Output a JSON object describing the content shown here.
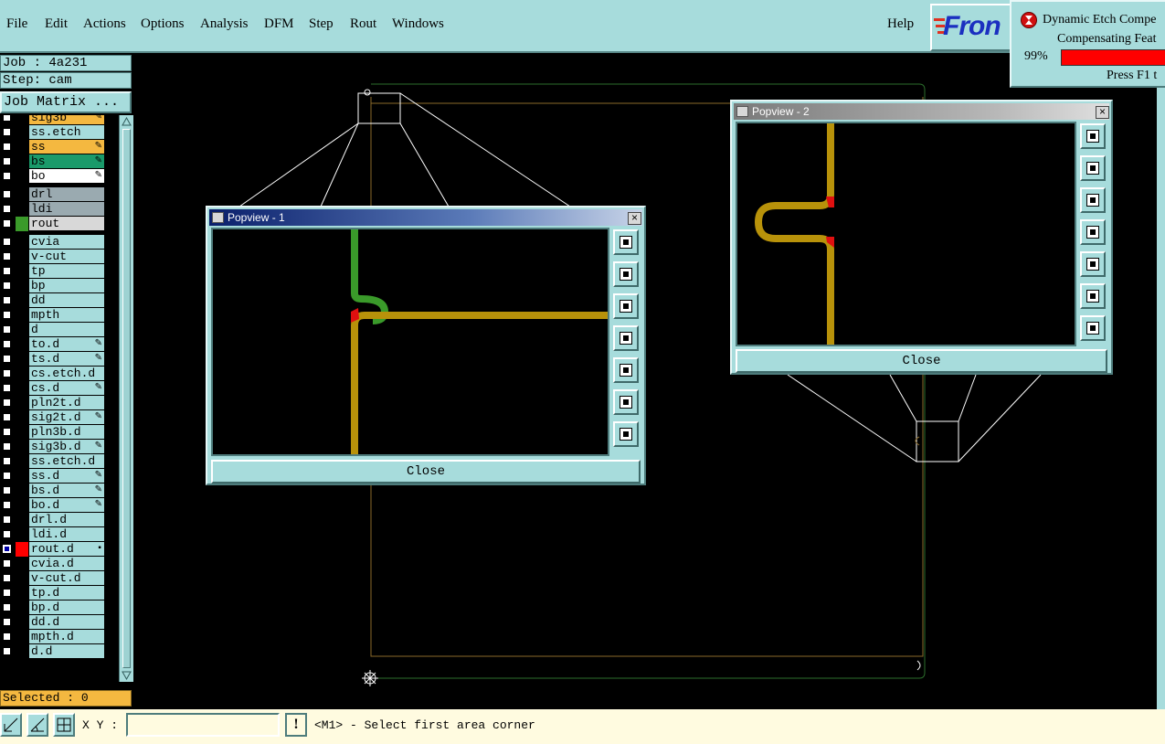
{
  "menu": {
    "file": "File",
    "edit": "Edit",
    "actions": "Actions",
    "options": "Options",
    "analysis": "Analysis",
    "dfm": "DFM",
    "step": "Step",
    "rout": "Rout",
    "windows": "Windows",
    "help": "Help"
  },
  "logo": {
    "text": "Fron"
  },
  "progress": {
    "title": "Dynamic Etch Compe",
    "subtitle": "Compensating Feat",
    "percent_label": "99%",
    "percent": 99,
    "hint": "Press F1 t",
    "bar_color": "#ff0000"
  },
  "job": {
    "job_label": "Job : 4a231",
    "step_label": "Step: cam",
    "matrix_button": "Job Matrix ..."
  },
  "layers": [
    {
      "name": "sig3b",
      "color": "#f4b840",
      "flag": "✎"
    },
    {
      "name": "ss.etch",
      "color": "#a7dcdc",
      "flag": ""
    },
    {
      "name": "ss",
      "color": "#f4b840",
      "flag": "✎"
    },
    {
      "name": "bs",
      "color": "#1a9a6a",
      "flag": "✎"
    },
    {
      "name": "bo",
      "color": "#ffffff",
      "flag": "✎"
    },
    {
      "name": "drl",
      "color": "#9aaab0",
      "flag": ""
    },
    {
      "name": "ldi",
      "color": "#9aaab0",
      "flag": ""
    },
    {
      "name": "rout",
      "color": "#d8d8d8",
      "flag": "",
      "swatch": "#3a9a2a"
    },
    {
      "name": "cvia",
      "color": "#a7dcdc",
      "flag": ""
    },
    {
      "name": "v-cut",
      "color": "#a7dcdc",
      "flag": ""
    },
    {
      "name": "tp",
      "color": "#a7dcdc",
      "flag": ""
    },
    {
      "name": "bp",
      "color": "#a7dcdc",
      "flag": ""
    },
    {
      "name": "dd",
      "color": "#a7dcdc",
      "flag": ""
    },
    {
      "name": "mpth",
      "color": "#a7dcdc",
      "flag": ""
    },
    {
      "name": "d",
      "color": "#a7dcdc",
      "flag": ""
    },
    {
      "name": "to.d",
      "color": "#a7dcdc",
      "flag": "✎"
    },
    {
      "name": "ts.d",
      "color": "#a7dcdc",
      "flag": "✎"
    },
    {
      "name": "cs.etch.d",
      "color": "#a7dcdc",
      "flag": ""
    },
    {
      "name": "cs.d",
      "color": "#a7dcdc",
      "flag": "✎"
    },
    {
      "name": "pln2t.d",
      "color": "#a7dcdc",
      "flag": ""
    },
    {
      "name": "sig2t.d",
      "color": "#a7dcdc",
      "flag": "✎"
    },
    {
      "name": "pln3b.d",
      "color": "#a7dcdc",
      "flag": ""
    },
    {
      "name": "sig3b.d",
      "color": "#a7dcdc",
      "flag": "✎"
    },
    {
      "name": "ss.etch.d",
      "color": "#a7dcdc",
      "flag": ""
    },
    {
      "name": "ss.d",
      "color": "#a7dcdc",
      "flag": "✎"
    },
    {
      "name": "bs.d",
      "color": "#a7dcdc",
      "flag": "✎"
    },
    {
      "name": "bo.d",
      "color": "#a7dcdc",
      "flag": "✎"
    },
    {
      "name": "drl.d",
      "color": "#a7dcdc",
      "flag": ""
    },
    {
      "name": "ldi.d",
      "color": "#a7dcdc",
      "flag": ""
    },
    {
      "name": "rout.d",
      "color": "#a7dcdc",
      "flag": "▪",
      "swatch": "#ff0000",
      "checked": true
    },
    {
      "name": "cvia.d",
      "color": "#a7dcdc",
      "flag": ""
    },
    {
      "name": "v-cut.d",
      "color": "#a7dcdc",
      "flag": ""
    },
    {
      "name": "tp.d",
      "color": "#a7dcdc",
      "flag": ""
    },
    {
      "name": "bp.d",
      "color": "#a7dcdc",
      "flag": ""
    },
    {
      "name": "dd.d",
      "color": "#a7dcdc",
      "flag": ""
    },
    {
      "name": "mpth.d",
      "color": "#a7dcdc",
      "flag": ""
    },
    {
      "name": "d.d",
      "color": "#a7dcdc",
      "flag": ""
    }
  ],
  "selected": {
    "label": "Selected : 0"
  },
  "status": {
    "xy_label": "X Y :",
    "xy_value": "",
    "alert": "!",
    "message": "<M1> - Select first area corner"
  },
  "popview1": {
    "title": "Popview - 1",
    "close_x": "×",
    "close_button": "Close"
  },
  "popview2": {
    "title": "Popview - 2",
    "close_x": "×",
    "close_button": "Close"
  },
  "colors": {
    "ui_bg": "#a7dcdc",
    "title_active": "#0a1f6b",
    "title_inactive": "#8a8a8a",
    "trace": "#b8920a",
    "trace_green": "#3a9a2a",
    "etch_red": "#e01010"
  }
}
